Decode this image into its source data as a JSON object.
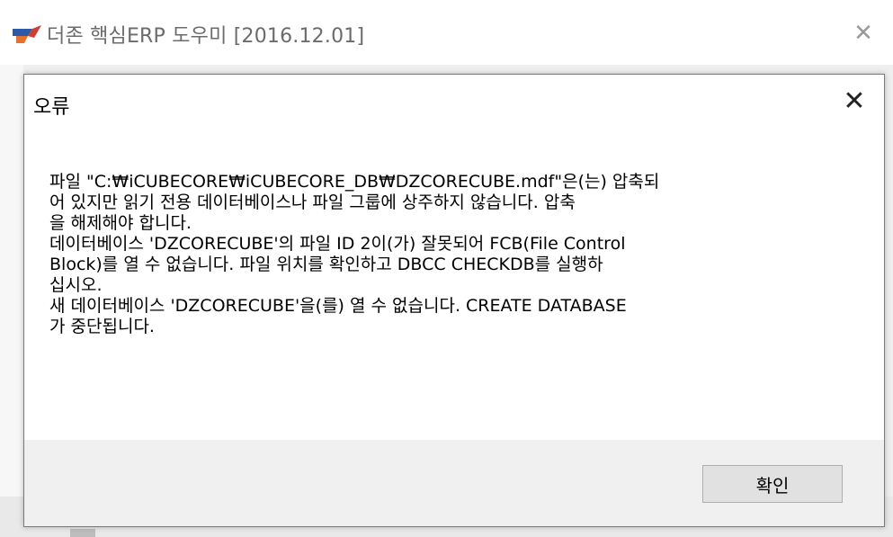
{
  "app": {
    "title": "더존 핵심ERP 도우미 [2016.12.01]",
    "close_icon": "close-icon"
  },
  "dialog": {
    "title": "오류",
    "close_icon": "close-icon",
    "message_lines": [
      "파일 \"C:₩iCUBECORE₩iCUBECORE_DB₩DZCORECUBE.mdf\"은(는) 압축되",
      "어 있지만 읽기 전용 데이터베이스나 파일 그룹에 상주하지 않습니다. 압축",
      "을 해제해야 합니다.",
      "데이터베이스 'DZCORECUBE'의 파일 ID 2이(가) 잘못되어 FCB(File Control",
      "Block)를 열 수 없습니다. 파일 위치를 확인하고 DBCC CHECKDB를 실행하",
      "십시오.",
      "새 데이터베이스 'DZCORECUBE'을(를) 열 수 없습니다. CREATE DATABASE",
      "가 중단됩니다."
    ],
    "ok_label": "확인"
  },
  "colors": {
    "logo_blue": "#2b5aa8",
    "logo_orange": "#e8702a",
    "logo_red": "#d43b2a"
  }
}
